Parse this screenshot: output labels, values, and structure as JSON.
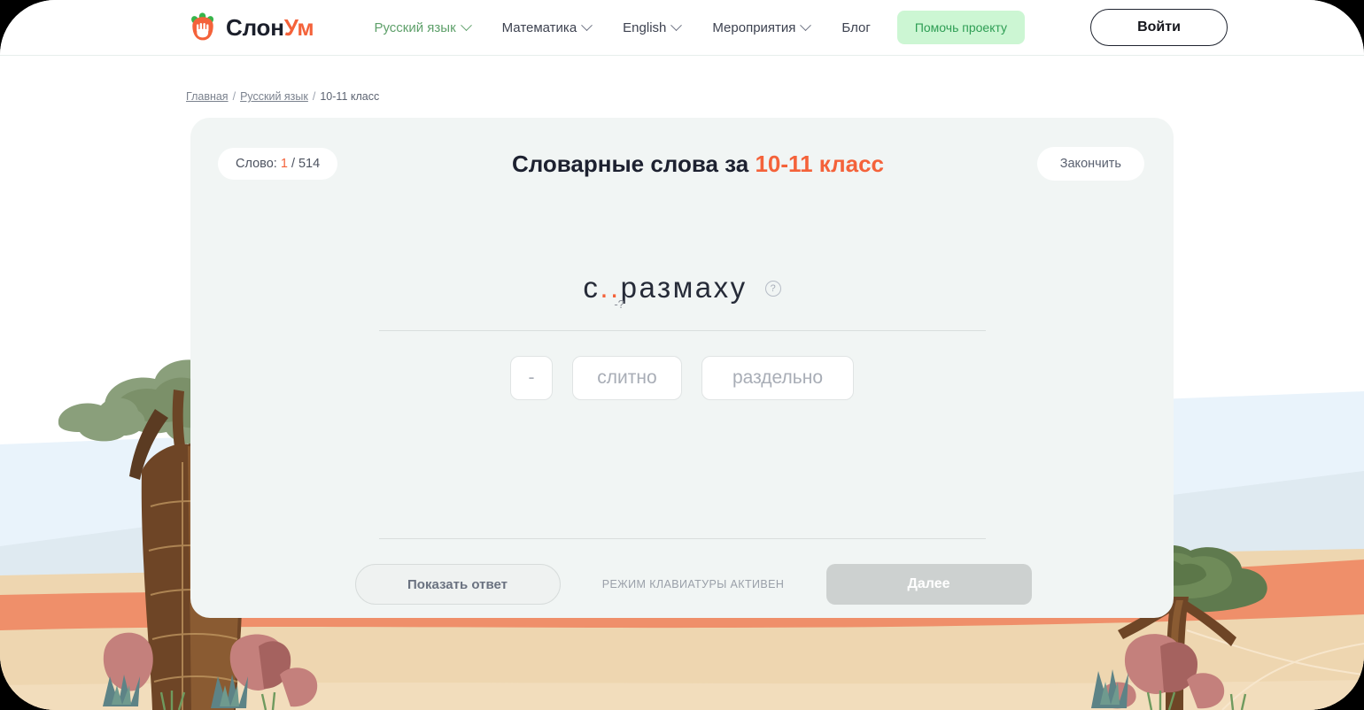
{
  "header": {
    "logo": {
      "icon": "elephant-hand-logo-icon",
      "text_dark": "Слон",
      "text_accent": "Ум"
    },
    "nav": [
      {
        "label": "Русский язык",
        "has_dropdown": true,
        "active": true
      },
      {
        "label": "Математика",
        "has_dropdown": true,
        "active": false
      },
      {
        "label": "English",
        "has_dropdown": true,
        "active": false
      },
      {
        "label": "Мероприятия",
        "has_dropdown": true,
        "active": false
      },
      {
        "label": "Блог",
        "has_dropdown": false,
        "active": false
      }
    ],
    "help_project_label": "Помочь проекту",
    "login_label": "Войти"
  },
  "breadcrumb": {
    "home": "Главная",
    "sep": "/",
    "subject": "Русский язык",
    "current": "10-11 класс"
  },
  "card": {
    "counter": {
      "prefix": "Слово:",
      "current": "1",
      "total": "/ 514"
    },
    "title_main": "Словарные слова за",
    "title_grade": "10-11 класс",
    "finish_label": "Закончить",
    "word": {
      "before": "с",
      "gap": "..",
      "after": "размаху",
      "hint": "-?",
      "help_icon": "question-circle-icon"
    },
    "options": [
      {
        "label": "-"
      },
      {
        "label": "слитно"
      },
      {
        "label": "раздельно"
      }
    ],
    "show_answer_label": "Показать ответ",
    "keyboard_mode_label": "Режим клавиатуры активен",
    "next_label": "Далее"
  },
  "colors": {
    "accent_orange": "#f4623a",
    "green": "#5ea06a",
    "green_soft_bg": "#ccf6d3",
    "card_bg": "#f1f5f4",
    "sky": "#e8f2fa",
    "sand": "#eed6b0",
    "coral": "#ef8f6a"
  }
}
